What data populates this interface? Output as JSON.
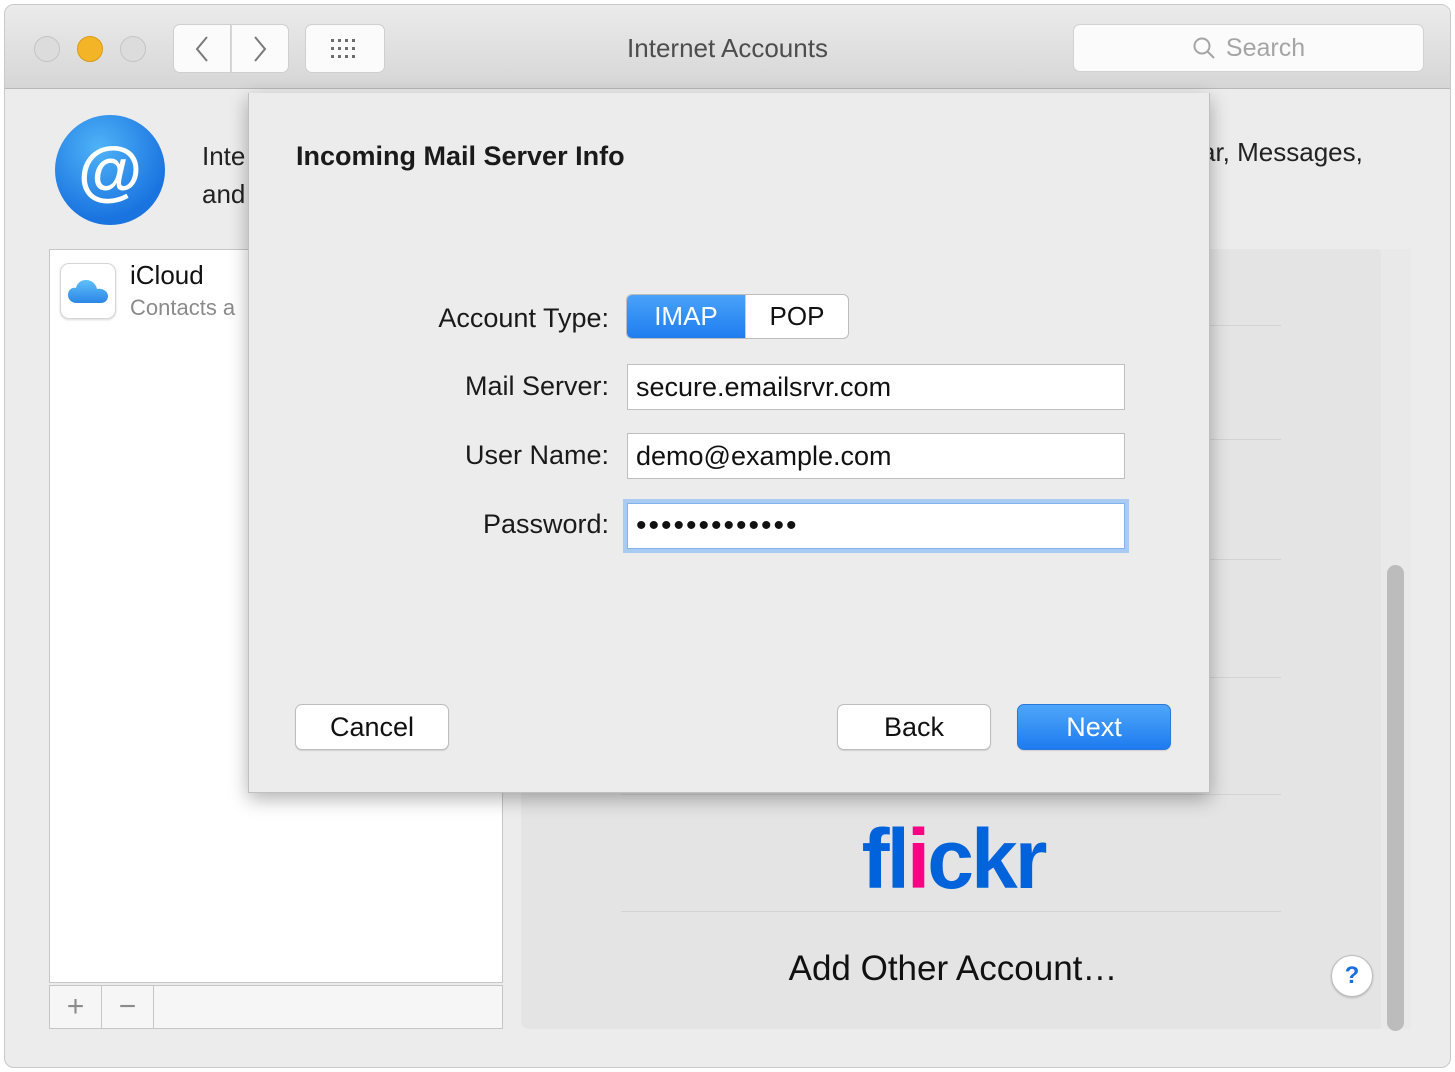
{
  "window": {
    "title": "Internet Accounts",
    "search_placeholder": "Search"
  },
  "header": {
    "intro_left_line1": "Inte",
    "intro_left_line2": "and",
    "intro_right": "ar, Messages,"
  },
  "accounts": {
    "items": [
      {
        "name": "iCloud",
        "subtitle": "Contacts a"
      }
    ],
    "add_label": "+",
    "remove_label": "−"
  },
  "providers": {
    "flickr_part1": "fl",
    "flickr_part2": "i",
    "flickr_part3": "ckr",
    "add_other_label": "Add Other Account…",
    "help_label": "?"
  },
  "sheet": {
    "title": "Incoming Mail Server Info",
    "account_type_label": "Account Type:",
    "account_type_options": [
      "IMAP",
      "POP"
    ],
    "account_type_selected": "IMAP",
    "mail_server_label": "Mail Server:",
    "mail_server_value": "secure.emailsrvr.com",
    "user_name_label": "User Name:",
    "user_name_value": "demo@example.com",
    "password_label": "Password:",
    "password_value": "•••••••••••••",
    "cancel_label": "Cancel",
    "back_label": "Back",
    "next_label": "Next"
  },
  "colors": {
    "accent": "#1f7df0",
    "traffic_minimize": "#f3b428",
    "flickr_blue": "#0063dc",
    "flickr_pink": "#ff0084"
  }
}
